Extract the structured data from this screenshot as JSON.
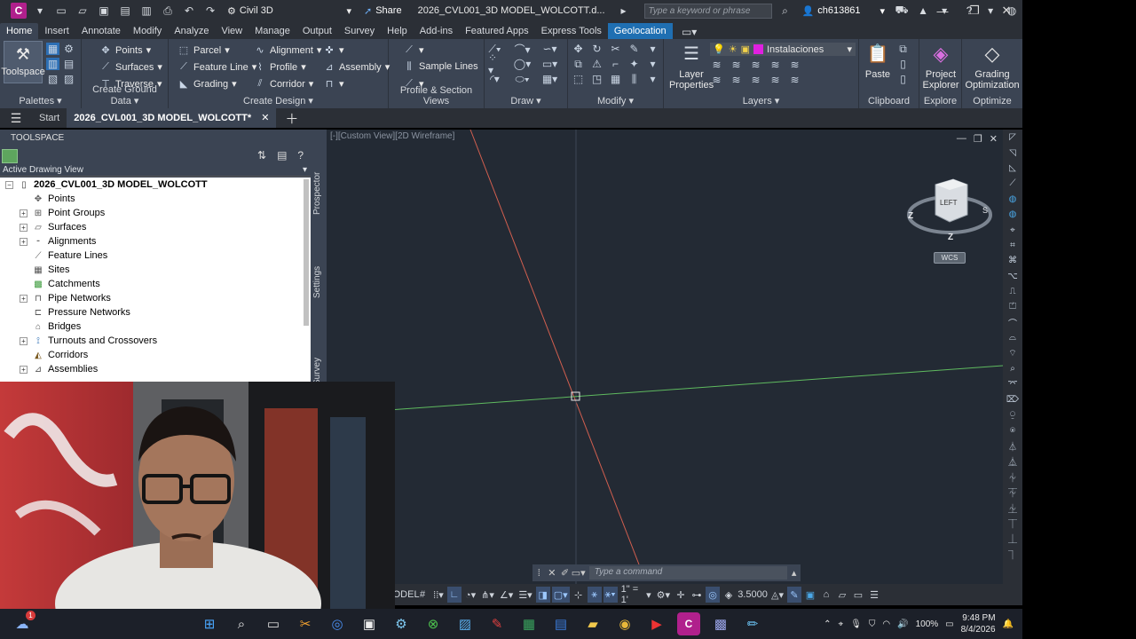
{
  "titlebar": {
    "app_letter": "C",
    "workspace": "Civil 3D",
    "share_label": "Share",
    "document_title": "2026_CVL001_3D MODEL_WOLCOTT.d...",
    "search_placeholder": "Type a keyword or phrase",
    "username": "ch613861",
    "window_controls": [
      "minimize",
      "restore",
      "close"
    ]
  },
  "ribbon_tabs": [
    "Home",
    "Insert",
    "Annotate",
    "Modify",
    "Analyze",
    "View",
    "Manage",
    "Output",
    "Survey",
    "Help",
    "Add-ins",
    "Featured Apps",
    "Express Tools",
    "Geolocation"
  ],
  "ribbon": {
    "palettes": {
      "title": "Palettes",
      "toolspace": "Toolspace"
    },
    "ground": {
      "title": "Create Ground Data",
      "points": "Points",
      "surfaces": "Surfaces",
      "traverse": "Traverse"
    },
    "design": {
      "title": "Create Design",
      "parcel": "Parcel",
      "feature_line": "Feature Line",
      "grading": "Grading",
      "alignment": "Alignment",
      "profile": "Profile",
      "corridor": "Corridor",
      "assembly": "Assembly"
    },
    "profile_section": {
      "title": "Profile & Section Views",
      "sample_lines": "Sample Lines"
    },
    "draw": {
      "title": "Draw"
    },
    "modify": {
      "title": "Modify"
    },
    "layers": {
      "title": "Layers",
      "layer_properties": "Layer Properties",
      "current_layer": "Instalaciones",
      "current_layer_color": "#e020e0"
    },
    "clipboard": {
      "title": "Clipboard",
      "paste": "Paste"
    },
    "explore": {
      "title": "Explore",
      "project_explorer": "Project Explorer"
    },
    "optimize": {
      "title": "Optimize",
      "grading_optimization": "Grading Optimization"
    }
  },
  "doc_tabs": {
    "start": "Start",
    "active": "2026_CVL001_3D MODEL_WOLCOTT*"
  },
  "toolspace": {
    "title": "TOOLSPACE",
    "view": "Active Drawing View",
    "root": "2026_CVL001_3D MODEL_WOLCOTT",
    "items": [
      {
        "label": "Points",
        "expandable": false
      },
      {
        "label": "Point Groups",
        "expandable": true
      },
      {
        "label": "Surfaces",
        "expandable": true
      },
      {
        "label": "Alignments",
        "expandable": true
      },
      {
        "label": "Feature Lines",
        "expandable": false
      },
      {
        "label": "Sites",
        "expandable": false
      },
      {
        "label": "Catchments",
        "expandable": false
      },
      {
        "label": "Pipe Networks",
        "expandable": true
      },
      {
        "label": "Pressure Networks",
        "expandable": false
      },
      {
        "label": "Bridges",
        "expandable": false
      },
      {
        "label": "Turnouts and Crossovers",
        "expandable": true
      },
      {
        "label": "Corridors",
        "expandable": false
      },
      {
        "label": "Assemblies",
        "expandable": true
      }
    ],
    "side_tabs": [
      "Prospector",
      "Settings",
      "Survey"
    ]
  },
  "viewport": {
    "label": "[-][Custom View][2D Wireframe]",
    "viewcube_face": "LEFT",
    "wcs_label": "WCS",
    "x_axis_color": "#e06a5a",
    "y_axis_color": "#6fc76f"
  },
  "command_line": {
    "placeholder": "Type a command"
  },
  "statusbar": {
    "model_label": "MODEL",
    "scale": "1\" = 1'",
    "value": "3.5000"
  },
  "taskbar": {
    "battery": "100%",
    "time": "9:48 PM",
    "date": "8/4/2026",
    "notification_badge": "1"
  }
}
